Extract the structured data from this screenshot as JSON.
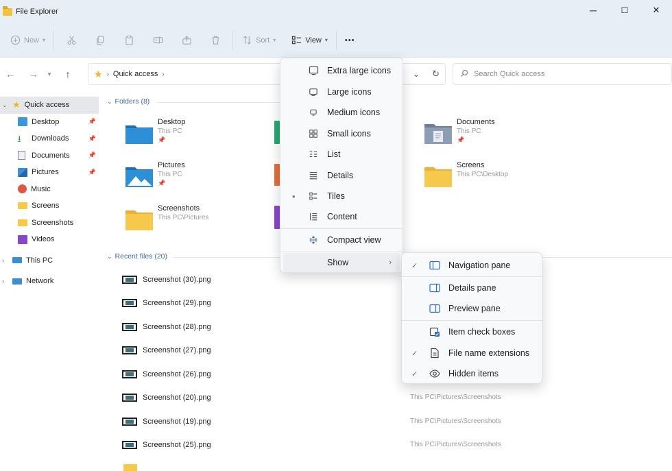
{
  "window": {
    "title": "File Explorer",
    "minimize": "─",
    "maximize": "☐",
    "close": "✕"
  },
  "toolbar": {
    "new_label": "New",
    "sort_label": "Sort",
    "view_label": "View",
    "more_label": "•••"
  },
  "address": {
    "crumb": "Quick access",
    "search_placeholder": "Search Quick access"
  },
  "sidebar": {
    "items": [
      {
        "label": "Quick access"
      },
      {
        "label": "Desktop"
      },
      {
        "label": "Downloads"
      },
      {
        "label": "Documents"
      },
      {
        "label": "Pictures"
      },
      {
        "label": "Music"
      },
      {
        "label": "Screens"
      },
      {
        "label": "Screenshots"
      },
      {
        "label": "Videos"
      },
      {
        "label": "This PC"
      },
      {
        "label": "Network"
      }
    ]
  },
  "folders": {
    "header": "Folders (8)",
    "items": [
      {
        "name": "Desktop",
        "sub": "This PC"
      },
      {
        "name": "Pictures",
        "sub": "This PC"
      },
      {
        "name": "Screenshots",
        "sub": "This PC\\Pictures"
      },
      {
        "name": "Documents",
        "sub": "This PC"
      },
      {
        "name": "Screens",
        "sub": "This PC\\Desktop"
      }
    ]
  },
  "recent": {
    "header": "Recent files (20)",
    "files": [
      {
        "name": "Screenshot (30).png"
      },
      {
        "name": "Screenshot (29).png"
      },
      {
        "name": "Screenshot (28).png"
      },
      {
        "name": "Screenshot (27).png"
      },
      {
        "name": "Screenshot (26).png"
      },
      {
        "name": "Screenshot (20).png",
        "location": "This PC\\Pictures\\Screenshots"
      },
      {
        "name": "Screenshot (19).png",
        "location": "This PC\\Pictures\\Screenshots"
      },
      {
        "name": "Screenshot (25).png",
        "location": "This PC\\Pictures\\Screenshots"
      }
    ]
  },
  "view_menu": {
    "items": [
      {
        "label": "Extra large icons"
      },
      {
        "label": "Large icons"
      },
      {
        "label": "Medium icons"
      },
      {
        "label": "Small icons"
      },
      {
        "label": "List"
      },
      {
        "label": "Details"
      },
      {
        "label": "Tiles",
        "selected_mark": "•"
      },
      {
        "label": "Content"
      },
      {
        "label": "Compact view"
      },
      {
        "label": "Show",
        "arrow": "›"
      }
    ]
  },
  "show_menu": {
    "items": [
      {
        "label": "Navigation pane",
        "check": "✓"
      },
      {
        "label": "Details pane"
      },
      {
        "label": "Preview pane"
      },
      {
        "label": "Item check boxes"
      },
      {
        "label": "File name extensions",
        "check": "✓"
      },
      {
        "label": "Hidden items",
        "check": "✓"
      }
    ]
  },
  "colors": {
    "folder_yellow": "#f6c84c",
    "folder_blue": "#2d8fd5",
    "accent_text": "#4568a6",
    "titlebar_bg": "#e8eef6"
  }
}
